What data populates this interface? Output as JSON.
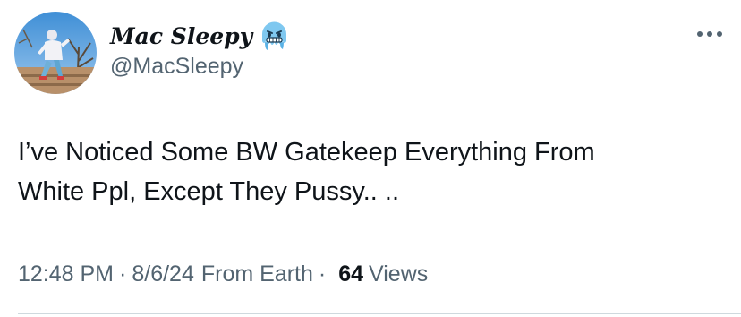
{
  "author": {
    "display_name": "Mac Sleepy",
    "emoji_icon": "cold-face-emoji",
    "handle": "@MacSleepy",
    "avatar_icon": "profile-photo"
  },
  "tweet": {
    "text": "I’ve Noticed Some BW Gatekeep Everything From\nWhite Ppl, Except They Pussy.. .."
  },
  "meta": {
    "time": "12:48 PM",
    "separator": "·",
    "date": "8/6/24",
    "location": "From Earth",
    "views_count": "64",
    "views_label": "Views"
  },
  "icons": {
    "more": "more-horizontal-icon"
  },
  "colors": {
    "text_primary": "#0f1419",
    "text_secondary": "#536471",
    "divider": "#cfd9de",
    "emoji_blue": "#7fc8f0"
  }
}
